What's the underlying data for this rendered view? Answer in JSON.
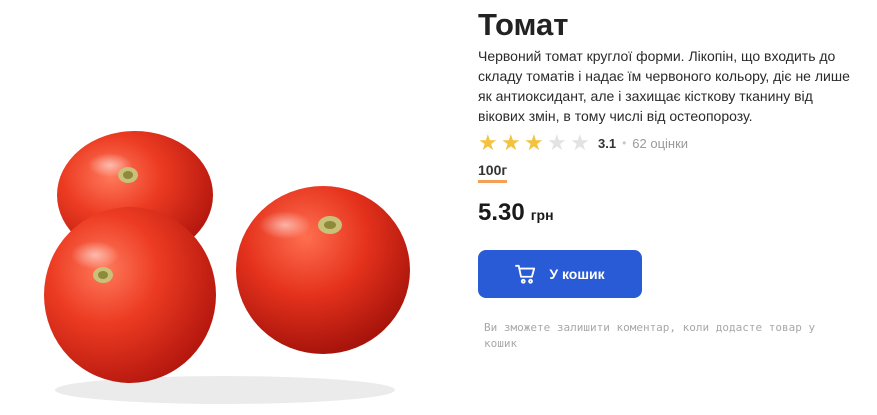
{
  "product": {
    "title": "Томат",
    "description": "Червоний томат круглої форми. Лікопін, що входить до складу томатів і надає їм червоного кольору, діє не лише як антиоксидант, але і захищає кісткову тканину від вікових змін, в тому числі від остеопорозу.",
    "rating": {
      "stars_filled": 3,
      "stars_total": 5,
      "value": "3.1",
      "count_text": "62 оцінки"
    },
    "weight": "100г",
    "price": "5.30",
    "currency": "грн",
    "cart_button_label": "У кошик",
    "note": "Ви зможете залишити коментар, коли додасте товар у кошик",
    "image": "tomatoes-photo"
  },
  "colors": {
    "accent": "#2a5bd7",
    "star": "#f3c340",
    "weight_underline": "#f4a056"
  }
}
